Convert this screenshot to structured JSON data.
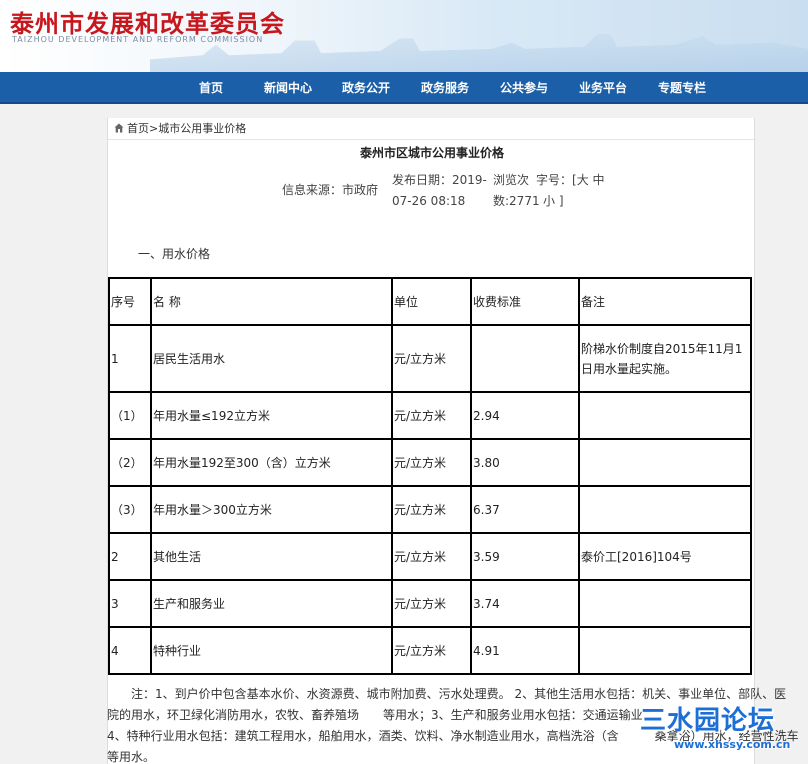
{
  "header": {
    "title": "泰州市发展和改革委员会",
    "subtitle": "TAIZHOU DEVELOPMENT AND REFORM COMMISSION"
  },
  "nav": [
    "首页",
    "新闻中心",
    "政务公开",
    "政务服务",
    "公共参与",
    "业务平台",
    "专题专栏"
  ],
  "breadcrumb": {
    "home": "首页",
    "separator": ">",
    "current": "城市公用事业价格"
  },
  "article": {
    "title": "泰州市区城市公用事业价格",
    "source_label": "信息来源：市政府",
    "date_line1": "发布日期：2019-",
    "date_line2": "07-26 08:18",
    "views_line1": "浏览次",
    "views_line2": "数:2771",
    "size_label": "字号：[",
    "size_large": "大",
    "size_medium": "中",
    "size_small": "小",
    "size_close": "]"
  },
  "section_heading": "一、用水价格",
  "table": {
    "headers": [
      "序号",
      "名 称",
      "单位",
      "收费标准",
      "备注"
    ],
    "rows": [
      [
        "1",
        "居民生活用水",
        "元/立方米",
        "",
        "阶梯水价制度自2015年11月1日用水量起实施。"
      ],
      [
        "（1）",
        "年用水量≤192立方米",
        "元/立方米",
        "2.94",
        ""
      ],
      [
        "（2）",
        "年用水量192至300（含）立方米",
        "元/立方米",
        "3.80",
        ""
      ],
      [
        "（3）",
        "年用水量＞300立方米",
        "元/立方米",
        "6.37",
        ""
      ],
      [
        "2",
        "其他生活",
        "元/立方米",
        "3.59",
        "泰价工[2016]104号"
      ],
      [
        "3",
        "生产和服务业",
        "元/立方米",
        "3.74",
        ""
      ],
      [
        "4",
        "特种行业",
        "元/立方米",
        "4.91",
        ""
      ]
    ]
  },
  "note": [
    "注：1、到户价中包含基本水价、水资源费、城市附加费、污水处理费。 2、其他生活用水包括：机关、事业单位、部队、医",
    "院的用水，环卫绿化消防用水，农牧、畜养殖场　　等用水；3、生产和服务业用水包括：交通运输业",
    "4、特种行业用水包括：建筑工程用水，船舶用水，酒类、饮料、净水制造业用水，高档洗浴（含　　　桑拿浴）用水，经营性洗车",
    "等用水。"
  ],
  "watermark": {
    "main": "三水园论坛",
    "url": "www.xhssy.com.cn"
  },
  "colors": {
    "nav": "#1b5fa8",
    "title": "#c8161d",
    "watermark": "#1d6fd6"
  }
}
